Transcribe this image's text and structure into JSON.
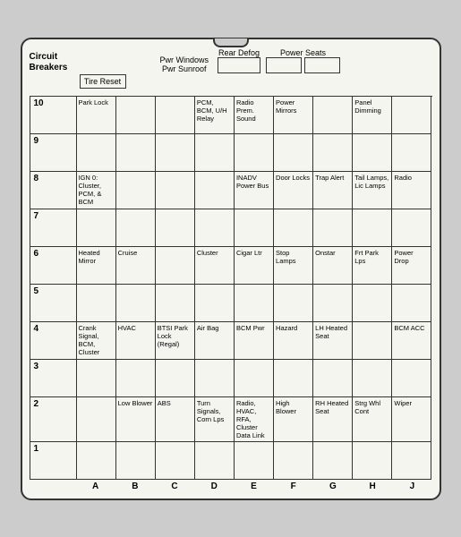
{
  "card": {
    "title": "Circuit Breakers",
    "top_labels": {
      "pwr_windows": "Pwr Windows",
      "pwr_sunroof": "Pwr Sunroof",
      "rear_defog": "Rear Defog",
      "power_seats": "Power Seats",
      "tire_reset": "Tire Reset"
    },
    "col_headers": [
      "A",
      "B",
      "C",
      "D",
      "E",
      "F",
      "G",
      "H",
      "J"
    ],
    "rows": [
      {
        "row_num": "10",
        "cells": [
          {
            "text": "Park Lock",
            "col": "A"
          },
          {
            "text": "",
            "col": "B"
          },
          {
            "text": "",
            "col": "C"
          },
          {
            "text": "PCM, BCM, U/H Relay",
            "col": "D"
          },
          {
            "text": "Radio Prem. Sound",
            "col": "E"
          },
          {
            "text": "Power Mirrors",
            "col": "F"
          },
          {
            "text": "",
            "col": "G"
          },
          {
            "text": "Panel Dimming",
            "col": "H"
          },
          {
            "text": "",
            "col": "J"
          }
        ]
      },
      {
        "row_num": "9",
        "cells": [
          {
            "text": "",
            "col": "A"
          },
          {
            "text": "",
            "col": "B"
          },
          {
            "text": "",
            "col": "C"
          },
          {
            "text": "",
            "col": "D"
          },
          {
            "text": "",
            "col": "E"
          },
          {
            "text": "",
            "col": "F"
          },
          {
            "text": "",
            "col": "G"
          },
          {
            "text": "",
            "col": "H"
          },
          {
            "text": "",
            "col": "J"
          }
        ]
      },
      {
        "row_num": "8",
        "cells": [
          {
            "text": "IGN 0: Cluster, PCM, & BCM",
            "col": "A"
          },
          {
            "text": "",
            "col": "B"
          },
          {
            "text": "",
            "col": "C"
          },
          {
            "text": "",
            "col": "D"
          },
          {
            "text": "INADV Power Bus",
            "col": "E"
          },
          {
            "text": "Door Locks",
            "col": "F"
          },
          {
            "text": "Trap Alert",
            "col": "G"
          },
          {
            "text": "Tail Lamps, Lic Lamps",
            "col": "H"
          },
          {
            "text": "Radio",
            "col": "J"
          }
        ]
      },
      {
        "row_num": "7",
        "cells": [
          {
            "text": "",
            "col": "A"
          },
          {
            "text": "",
            "col": "B"
          },
          {
            "text": "",
            "col": "C"
          },
          {
            "text": "",
            "col": "D"
          },
          {
            "text": "",
            "col": "E"
          },
          {
            "text": "",
            "col": "F"
          },
          {
            "text": "",
            "col": "G"
          },
          {
            "text": "",
            "col": "H"
          },
          {
            "text": "",
            "col": "J"
          }
        ]
      },
      {
        "row_num": "6",
        "cells": [
          {
            "text": "Heated Mirror",
            "col": "A"
          },
          {
            "text": "Cruise",
            "col": "B"
          },
          {
            "text": "",
            "col": "C"
          },
          {
            "text": "Cluster",
            "col": "D"
          },
          {
            "text": "Cigar Ltr",
            "col": "E"
          },
          {
            "text": "Stop Lamps",
            "col": "F"
          },
          {
            "text": "Onstar",
            "col": "G"
          },
          {
            "text": "Frt Park Lps",
            "col": "H"
          },
          {
            "text": "Power Drop",
            "col": "J"
          }
        ]
      },
      {
        "row_num": "5",
        "cells": [
          {
            "text": "",
            "col": "A"
          },
          {
            "text": "",
            "col": "B"
          },
          {
            "text": "",
            "col": "C"
          },
          {
            "text": "",
            "col": "D"
          },
          {
            "text": "",
            "col": "E"
          },
          {
            "text": "",
            "col": "F"
          },
          {
            "text": "",
            "col": "G"
          },
          {
            "text": "",
            "col": "H"
          },
          {
            "text": "",
            "col": "J"
          }
        ]
      },
      {
        "row_num": "4",
        "cells": [
          {
            "text": "Crank Signal, BCM, Cluster",
            "col": "A"
          },
          {
            "text": "HVAC",
            "col": "B"
          },
          {
            "text": "BTSI Park Lock (Regal)",
            "col": "C"
          },
          {
            "text": "Air Bag",
            "col": "D"
          },
          {
            "text": "BCM Pwr",
            "col": "E"
          },
          {
            "text": "Hazard",
            "col": "F"
          },
          {
            "text": "LH Heated Seat",
            "col": "G"
          },
          {
            "text": "",
            "col": "H"
          },
          {
            "text": "BCM ACC",
            "col": "J"
          }
        ]
      },
      {
        "row_num": "3",
        "cells": [
          {
            "text": "",
            "col": "A"
          },
          {
            "text": "",
            "col": "B"
          },
          {
            "text": "",
            "col": "C"
          },
          {
            "text": "",
            "col": "D"
          },
          {
            "text": "",
            "col": "E"
          },
          {
            "text": "",
            "col": "F"
          },
          {
            "text": "",
            "col": "G"
          },
          {
            "text": "",
            "col": "H"
          },
          {
            "text": "",
            "col": "J"
          }
        ]
      },
      {
        "row_num": "2",
        "cells": [
          {
            "text": "",
            "col": "A"
          },
          {
            "text": "Low Blower",
            "col": "B"
          },
          {
            "text": "ABS",
            "col": "C"
          },
          {
            "text": "Turn Signals, Corn Lps",
            "col": "D"
          },
          {
            "text": "Radio, HVAC, RFA, Cluster Data Link",
            "col": "E"
          },
          {
            "text": "High Blower",
            "col": "F"
          },
          {
            "text": "RH Heated Seat",
            "col": "G"
          },
          {
            "text": "Strg Whl Cont",
            "col": "H"
          },
          {
            "text": "Wiper",
            "col": "J"
          }
        ]
      },
      {
        "row_num": "1",
        "cells": [
          {
            "text": "",
            "col": "A"
          },
          {
            "text": "",
            "col": "B"
          },
          {
            "text": "",
            "col": "C"
          },
          {
            "text": "",
            "col": "D"
          },
          {
            "text": "",
            "col": "E"
          },
          {
            "text": "",
            "col": "F"
          },
          {
            "text": "",
            "col": "G"
          },
          {
            "text": "",
            "col": "H"
          },
          {
            "text": "",
            "col": "J"
          }
        ]
      }
    ]
  }
}
